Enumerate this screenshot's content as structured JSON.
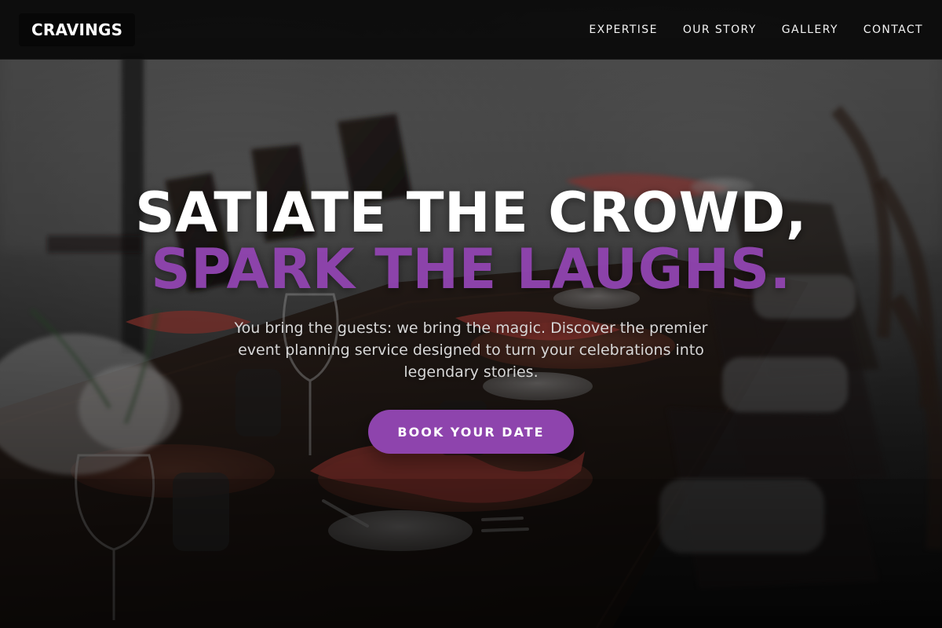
{
  "brand": {
    "name": "CRAVINGS",
    "accent_color": "#8e44ad"
  },
  "header": {
    "nav_items": [
      {
        "label": "EXPERTISE"
      },
      {
        "label": "OUR STORY"
      },
      {
        "label": "GALLERY"
      },
      {
        "label": "CONTACT"
      }
    ]
  },
  "hero": {
    "headline_line1": "SATIATE THE CROWD,",
    "headline_line2": "SPARK THE LAUGHS.",
    "subtitle": "You bring the guests: we bring the magic. Discover the premier event planning service designed to turn your celebrations into legendary stories.",
    "cta_label": "BOOK YOUR DATE"
  },
  "background": {
    "scene": "outdoor event table setting with chairs, plates, napkins, glasses, and floral centerpiece"
  }
}
